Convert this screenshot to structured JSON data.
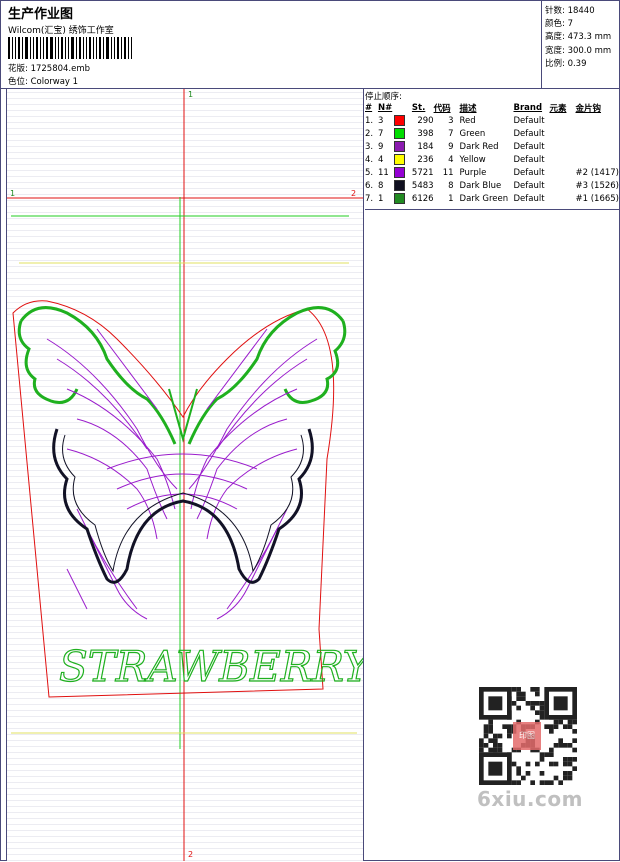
{
  "header": {
    "title": "生产作业图",
    "company": "Wilcom(汇宝) 绣饰工作室",
    "design_label": "花版:",
    "design_value": "1725804.emb",
    "colorway_label": "色位:",
    "colorway_value": "Colorway 1"
  },
  "stats": {
    "stitches": "针数: 18440",
    "colors": "颜色: 7",
    "height": "高度: 473.3 mm",
    "width": "宽度: 300.0 mm",
    "scale": "比例: 0.39"
  },
  "stop_sequence": {
    "title": "停止顺序:",
    "headers": [
      "#",
      "N#",
      "",
      "St.",
      "代码",
      "描述",
      "Brand",
      "元素",
      "金片钩"
    ],
    "rows": [
      {
        "seq": "1.",
        "needle": "3",
        "color": "#ff0000",
        "stitches": "290",
        "code": "3",
        "desc": "Red",
        "brand": "Default",
        "elements": "",
        "sequin": ""
      },
      {
        "seq": "2.",
        "needle": "7",
        "color": "#00dd00",
        "stitches": "398",
        "code": "7",
        "desc": "Green",
        "brand": "Default",
        "elements": "",
        "sequin": ""
      },
      {
        "seq": "3.",
        "needle": "9",
        "color": "#8b1bb0",
        "stitches": "184",
        "code": "9",
        "desc": "Dark Red",
        "brand": "Default",
        "elements": "",
        "sequin": ""
      },
      {
        "seq": "4.",
        "needle": "4",
        "color": "#ffff00",
        "stitches": "236",
        "code": "4",
        "desc": "Yellow",
        "brand": "Default",
        "elements": "",
        "sequin": ""
      },
      {
        "seq": "5.",
        "needle": "11",
        "color": "#9400d3",
        "stitches": "5721",
        "code": "11",
        "desc": "Purple",
        "brand": "Default",
        "elements": "",
        "sequin": "#2 (1417)"
      },
      {
        "seq": "6.",
        "needle": "8",
        "color": "#101020",
        "stitches": "5483",
        "code": "8",
        "desc": "Dark Blue",
        "brand": "Default",
        "elements": "",
        "sequin": "#3 (1526)"
      },
      {
        "seq": "7.",
        "needle": "1",
        "color": "#228b22",
        "stitches": "6126",
        "code": "1",
        "desc": "Dark Green",
        "brand": "Default",
        "elements": "",
        "sequin": "#1 (1665)"
      }
    ]
  },
  "canvas": {
    "markers": {
      "top": "1",
      "bottom": "2",
      "left": "1",
      "right": "2"
    },
    "text": "STRAWBERRY"
  },
  "watermark": {
    "seal": "印图",
    "site": "6xiu.com"
  }
}
